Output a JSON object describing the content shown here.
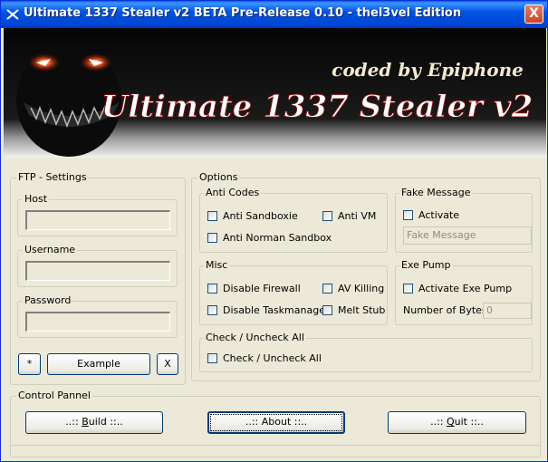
{
  "window": {
    "title": "Ultimate 1337 Stealer v2 BETA Pre-Release 0.10 - thel3vel Edition",
    "close_glyph": "X"
  },
  "banner": {
    "credit": "coded by Epiphone",
    "logo": "Ultimate 1337 Stealer v2"
  },
  "ftp": {
    "legend": "FTP - Settings",
    "host_label": "Host",
    "host_value": "",
    "username_label": "Username",
    "username_value": "",
    "password_label": "Password",
    "password_value": "",
    "small_button": "*",
    "example_button": "Example",
    "x_button": "X"
  },
  "options": {
    "legend": "Options",
    "anti_codes": {
      "legend": "Anti Codes",
      "items": [
        "Anti Sandboxie",
        "Anti VM",
        "Anti Norman Sandbox"
      ]
    },
    "misc": {
      "legend": "Misc",
      "items": [
        "Disable Firewall",
        "AV Killing",
        "Disable Taskmanager",
        "Melt Stub"
      ]
    },
    "check_all": {
      "legend": "Check / Uncheck All",
      "item": "Check / Uncheck All"
    },
    "fake_message": {
      "legend": "Fake Message",
      "activate": "Activate",
      "placeholder": "Fake Message"
    },
    "exe_pump": {
      "legend": "Exe Pump",
      "activate": "Activate Exe Pump",
      "bytes_label": "Number of Bytes:",
      "bytes_value": "0"
    }
  },
  "control": {
    "legend": "Control Pannel",
    "build": {
      "pre": "..:: ",
      "key": "B",
      "post": "uild ::.."
    },
    "about": "..:: About ::..",
    "quit": {
      "pre": "..:: ",
      "key": "Q",
      "post": "uit ::.."
    }
  },
  "colors": {
    "titlebar": "#0054e3",
    "window_bg": "#ece9d8",
    "banner_text": "#ffffff",
    "credit_text": "#f2e9d0",
    "eye_glow": "#ff3b1f"
  }
}
